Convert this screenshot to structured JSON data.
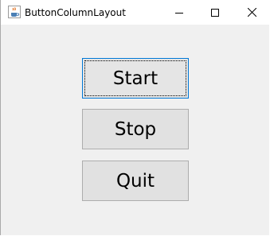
{
  "window": {
    "title": "ButtonColumnLayout",
    "icon": "java-coffee-cup-icon"
  },
  "title_controls": {
    "minimize_icon": "minimize-icon",
    "maximize_icon": "maximize-icon",
    "close_icon": "close-icon"
  },
  "buttons": {
    "start_label": "Start",
    "stop_label": "Stop",
    "quit_label": "Quit"
  },
  "colors": {
    "background": "#f0f0f0",
    "button_face": "#e1e1e1",
    "button_border": "#adadad",
    "focus_border": "#0078d7"
  }
}
